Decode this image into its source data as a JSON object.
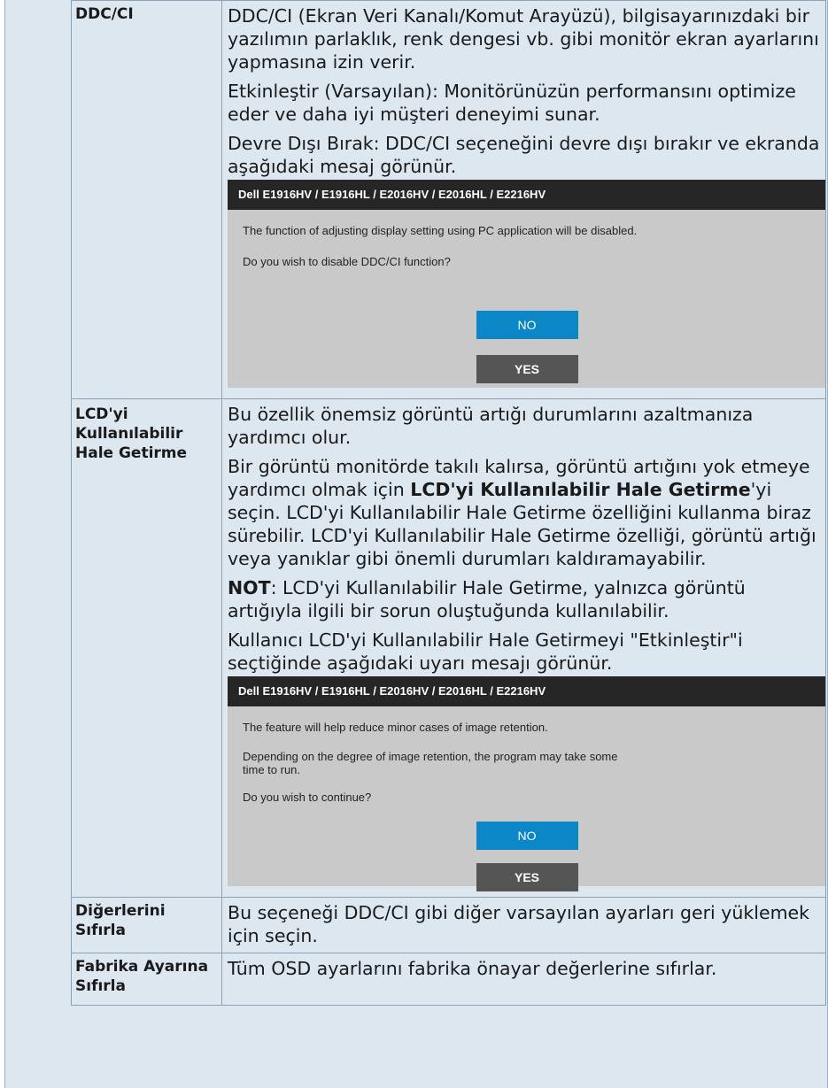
{
  "rows": {
    "ddc": {
      "label": "DDC/CI",
      "paragraphs": [
        "DDC/CI (Ekran Veri Kanalı/Komut Arayüzü), bilgisayarınızdaki bir yazılımın parlaklık, renk dengesi vb. gibi monitör ekran ayarlarını yapmasına izin verir.",
        "Etkinleştir (Varsayılan): Monitörünüzün performansını optimize eder ve daha iyi müşteri deneyimi sunar.",
        "Devre Dışı Bırak: DDC/CI seçeneğini devre dışı bırakır ve ekranda aşağıdaki mesaj görünür."
      ],
      "dialog": {
        "title": "Dell E1916HV / E1916HL / E2016HV / E2016HL / E2216HV",
        "lines": [
          "The function of adjusting display setting using PC application will be disabled.",
          "Do you wish to disable DDC/CI function?"
        ],
        "no_label": "NO",
        "yes_label": "YES"
      }
    },
    "lcd": {
      "label": "LCD'yi Kullanılabilir Hale Getirme",
      "p1": "Bu özellik önemsiz görüntü artığı durumlarını azaltmanıza yardımcı olur.",
      "p2_before": "Bir görüntü monitörde takılı kalırsa, görüntü artığını yok etmeye yardımcı olmak için ",
      "p2_bold": "LCD'yi Kullanılabilir Hale Getirme",
      "p2_after": "'yi seçin. LCD'yi Kullanılabilir Hale Getirme özelliğini kullanma biraz sürebilir. LCD'yi Kullanılabilir Hale Getirme özelliği, görüntü artığı veya yanıklar gibi önemli durumları kaldıramayabilir.",
      "p3_bold": "NOT",
      "p3_after": ": LCD'yi Kullanılabilir Hale Getirme, yalnızca görüntü artığıyla ilgili bir sorun oluştuğunda kullanılabilir.",
      "p4": "Kullanıcı LCD'yi Kullanılabilir Hale Getirmeyi \"Etkinleştir\"i seçtiğinde aşağıdaki uyarı mesajı görünür.",
      "dialog": {
        "title": "Dell E1916HV / E1916HL / E2016HV / E2016HL / E2216HV",
        "lines": [
          "The feature will help reduce minor cases of image retention.",
          "Depending on the degree of image retention, the program may take some time to run.",
          "Do you wish to continue?"
        ],
        "no_label": "NO",
        "yes_label": "YES"
      }
    },
    "reset_others": {
      "label": "Diğerlerini Sıfırla",
      "text": "Bu seçeneği DDC/CI gibi diğer varsayılan ayarları geri yüklemek için seçin."
    },
    "factory_reset": {
      "label": "Fabrika Ayarına Sıfırla",
      "text": "Tüm OSD ayarlarını fabrika önayar değerlerine sıfırlar."
    }
  },
  "colors": {
    "page_bg": "#dde7ef",
    "dialog_bg": "#c9c9c9",
    "dialog_title_bg": "#262626",
    "no_button": "#0b86c6",
    "yes_button": "#555555"
  }
}
